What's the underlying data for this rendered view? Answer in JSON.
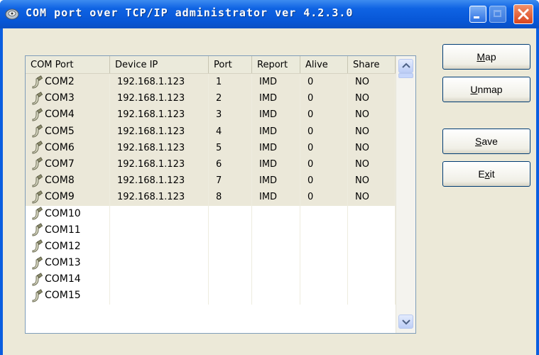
{
  "window": {
    "title": "COM port over TCP/IP administrator ver 4.2.3.0",
    "icon": "app-network-icon",
    "accent": "#0a5ee0"
  },
  "list": {
    "columns": [
      "COM Port",
      "Device IP",
      "Port",
      "Report",
      "Alive",
      "Share"
    ],
    "rows": [
      {
        "com": "COM2",
        "ip": "192.168.1.123",
        "port": "1",
        "report": "IMD",
        "alive": "0",
        "share": "NO"
      },
      {
        "com": "COM3",
        "ip": "192.168.1.123",
        "port": "2",
        "report": "IMD",
        "alive": "0",
        "share": "NO"
      },
      {
        "com": "COM4",
        "ip": "192.168.1.123",
        "port": "3",
        "report": "IMD",
        "alive": "0",
        "share": "NO"
      },
      {
        "com": "COM5",
        "ip": "192.168.1.123",
        "port": "4",
        "report": "IMD",
        "alive": "0",
        "share": "NO"
      },
      {
        "com": "COM6",
        "ip": "192.168.1.123",
        "port": "5",
        "report": "IMD",
        "alive": "0",
        "share": "NO"
      },
      {
        "com": "COM7",
        "ip": "192.168.1.123",
        "port": "6",
        "report": "IMD",
        "alive": "0",
        "share": "NO"
      },
      {
        "com": "COM8",
        "ip": "192.168.1.123",
        "port": "7",
        "report": "IMD",
        "alive": "0",
        "share": "NO"
      },
      {
        "com": "COM9",
        "ip": "192.168.1.123",
        "port": "8",
        "report": "IMD",
        "alive": "0",
        "share": "NO"
      },
      {
        "com": "COM10",
        "ip": "",
        "port": "",
        "report": "",
        "alive": "",
        "share": ""
      },
      {
        "com": "COM11",
        "ip": "",
        "port": "",
        "report": "",
        "alive": "",
        "share": ""
      },
      {
        "com": "COM12",
        "ip": "",
        "port": "",
        "report": "",
        "alive": "",
        "share": ""
      },
      {
        "com": "COM13",
        "ip": "",
        "port": "",
        "report": "",
        "alive": "",
        "share": ""
      },
      {
        "com": "COM14",
        "ip": "",
        "port": "",
        "report": "",
        "alive": "",
        "share": ""
      },
      {
        "com": "COM15",
        "ip": "",
        "port": "",
        "report": "",
        "alive": "",
        "share": ""
      }
    ]
  },
  "buttons": {
    "map": {
      "pre": "",
      "key": "M",
      "post": "ap"
    },
    "unmap": {
      "pre": "",
      "key": "U",
      "post": "nmap"
    },
    "save": {
      "pre": "",
      "key": "S",
      "post": "ave"
    },
    "exit": {
      "pre": "E",
      "key": "x",
      "post": "it"
    }
  }
}
